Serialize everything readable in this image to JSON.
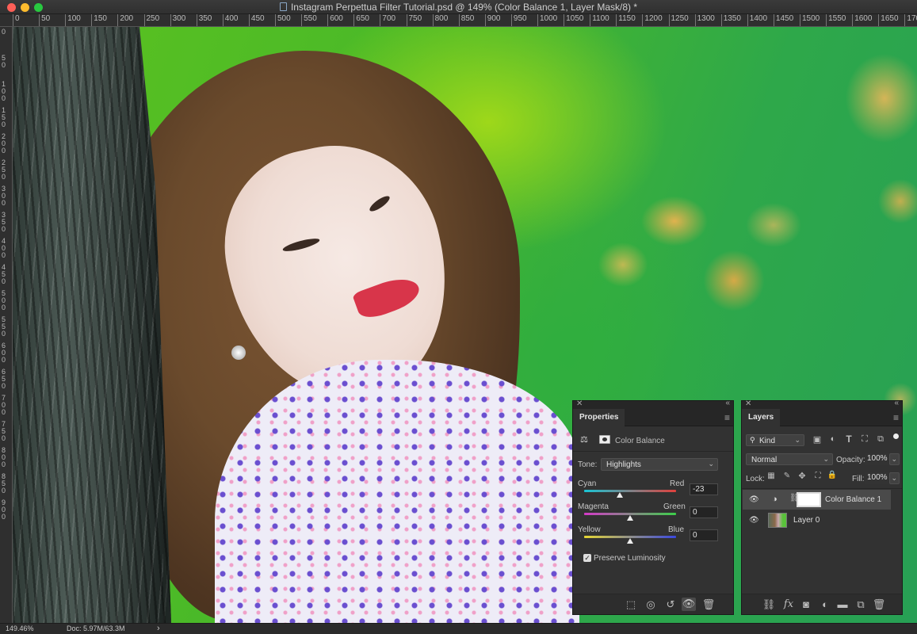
{
  "window": {
    "title": "Instagram Perpettua Filter Tutorial.psd @ 149% (Color Balance 1, Layer Mask/8) *"
  },
  "rulers": {
    "top_ticks": [
      "0",
      "50",
      "100",
      "150",
      "200",
      "250",
      "300",
      "350",
      "400",
      "450",
      "500",
      "550",
      "600",
      "650",
      "700",
      "750",
      "800",
      "850",
      "900",
      "950",
      "1000",
      "1050",
      "1100",
      "1150",
      "1200",
      "1250",
      "1300",
      "1350",
      "1400",
      "1450",
      "1500",
      "1550",
      "1600",
      "1650",
      "1700",
      "17"
    ],
    "left_ticks": [
      "0",
      "50",
      "100",
      "150",
      "200",
      "250",
      "300",
      "350",
      "400",
      "450",
      "500",
      "550",
      "600",
      "650",
      "700",
      "750",
      "800",
      "850",
      "900"
    ]
  },
  "properties": {
    "tab_label": "Properties",
    "adjustment_name": "Color Balance",
    "tone_label": "Tone:",
    "tone_value": "Highlights",
    "sliders": [
      {
        "left_label": "Cyan",
        "right_label": "Red",
        "value": "-23",
        "level": -23
      },
      {
        "left_label": "Magenta",
        "right_label": "Green",
        "value": "0",
        "level": 0
      },
      {
        "left_label": "Yellow",
        "right_label": "Blue",
        "value": "0",
        "level": 0
      }
    ],
    "preserve_luminosity_label": "Preserve Luminosity",
    "preserve_luminosity_checked": true
  },
  "layers": {
    "tab_label": "Layers",
    "filter_kind": "Kind",
    "blend_mode": "Normal",
    "opacity_label": "Opacity:",
    "opacity_value": "100%",
    "lock_label": "Lock:",
    "fill_label": "Fill:",
    "fill_value": "100%",
    "items": [
      {
        "name": "Color Balance 1",
        "selected": true
      },
      {
        "name": "Layer 0",
        "selected": false
      }
    ]
  },
  "status": {
    "zoom": "149.46%",
    "doc": "Doc: 5.97M/63.3M",
    "arrow": "›"
  },
  "colors": {
    "panel_bg": "#323232",
    "canvas_border": "#2b2b2b"
  }
}
